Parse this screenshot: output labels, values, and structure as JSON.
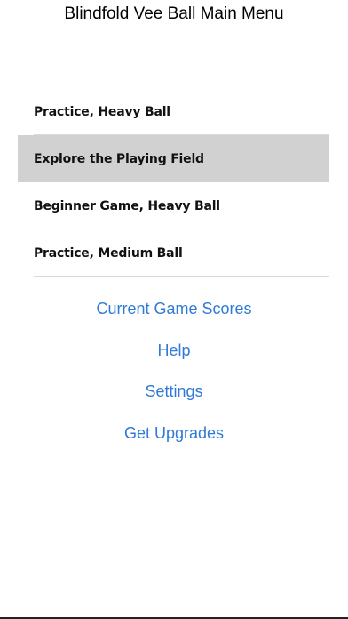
{
  "nav": {
    "title": "Blindfold Vee Ball Main Menu"
  },
  "menu": {
    "items": [
      {
        "label": "Practice, Heavy Ball",
        "selected": false
      },
      {
        "label": "Explore the Playing Field",
        "selected": true
      },
      {
        "label": "Beginner Game, Heavy Ball",
        "selected": false
      },
      {
        "label": "Practice, Medium Ball",
        "selected": false
      }
    ]
  },
  "links": {
    "current_scores": "Current Game Scores",
    "help": "Help",
    "settings": "Settings",
    "upgrades": "Get Upgrades"
  },
  "colors": {
    "link": "#2f7ad6",
    "selected_row": "#d1d1d1",
    "separator": "#d9d9d9"
  }
}
